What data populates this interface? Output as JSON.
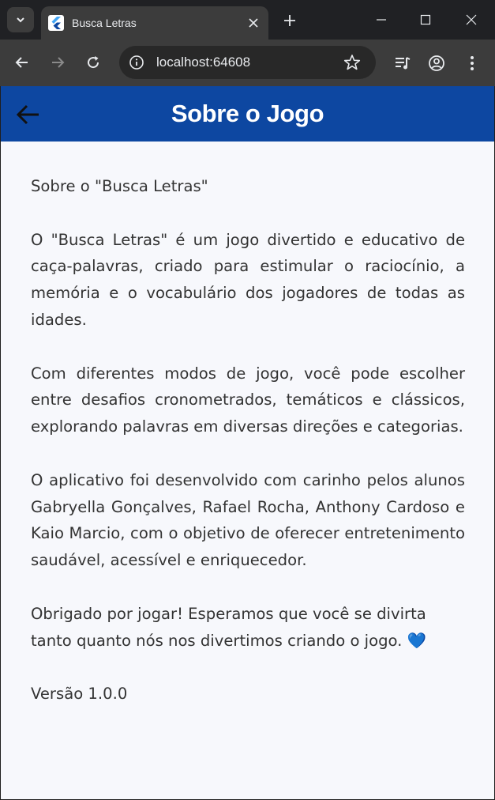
{
  "browser": {
    "tab_title": "Busca Letras",
    "url": "localhost:64608"
  },
  "appbar": {
    "title": "Sobre o Jogo"
  },
  "content": {
    "heading": "Sobre o \"Busca Letras\"",
    "p1": "O \"Busca Letras\" é um jogo divertido e educativo de caça-palavras, criado para estimular o raciocínio, a memória e o vocabulário dos jogadores de todas as idades.",
    "p2": "Com diferentes modos de jogo, você pode escolher entre desafios cronometrados, temáticos e clássicos, explorando palavras em diversas direções e categorias.",
    "p3": "O aplicativo foi desenvolvido com carinho pelos alunos Gabryella Gonçalves, Rafael Rocha, Anthony Cardoso e Kaio Marcio, com o objetivo de oferecer entretenimento saudável, acessível e enriquecedor.",
    "p4": "Obrigado por jogar! Esperamos que você se divirta tanto quanto nós nos divertimos criando o jogo.",
    "p4_emoji": "💙",
    "version": "Versão 1.0.0"
  },
  "icons": {
    "tab_search": "chevron-down-icon",
    "favicon": "flutter-icon",
    "tab_close": "close-icon",
    "new_tab": "plus-icon",
    "back": "arrow-left-icon",
    "forward": "arrow-right-icon",
    "reload": "reload-icon",
    "site_info": "info-icon",
    "bookmark": "star-icon",
    "media": "media-control-icon",
    "profile": "account-icon",
    "menu": "more-vertical-icon"
  },
  "colors": {
    "appbar": "#0d47a1",
    "background": "#f7f8fc",
    "text": "#333333",
    "heart": "#1e88e5"
  }
}
